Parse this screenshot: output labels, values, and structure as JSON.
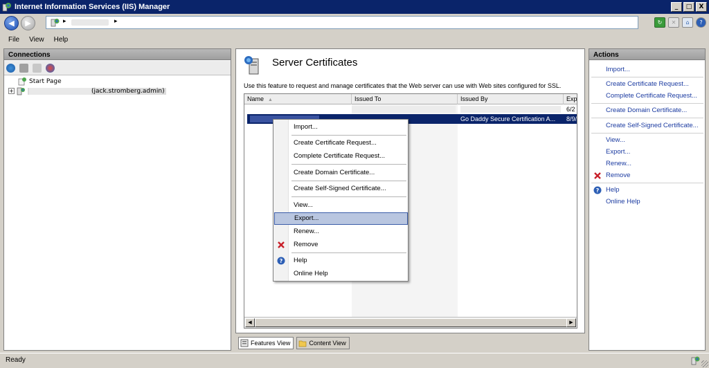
{
  "window": {
    "title": "Internet Information Services (IIS) Manager",
    "min_label": "_",
    "max_label": "□",
    "close_label": "X"
  },
  "nav": {
    "back_label": "◀",
    "forward_label": "▶",
    "address_arrow": "▸",
    "address_arrow2": "▸"
  },
  "menu": [
    {
      "label": "File"
    },
    {
      "label": "View"
    },
    {
      "label": "Help"
    }
  ],
  "connections": {
    "title": "Connections",
    "tree": [
      {
        "label": "Start Page"
      },
      {
        "label": "(jack.stromberg.admin)",
        "expander": "+"
      }
    ]
  },
  "feature": {
    "title": "Server Certificates",
    "description": "Use this feature to request and manage certificates that the Web server can use with Web sites configured for SSL."
  },
  "grid": {
    "columns": [
      "Name",
      "Issued To",
      "Issued By",
      "Exp"
    ],
    "sort_indicator": "▲",
    "rows": [
      {
        "name": "",
        "issued_to": "",
        "issued_by": "",
        "exp": "6/2"
      },
      {
        "name": "",
        "issued_to": "",
        "issued_by": "Go Daddy Secure Certification A...",
        "exp": "8/9/"
      }
    ],
    "scroll_left": "◀",
    "scroll_right": "▶"
  },
  "view_tabs": {
    "features": "Features View",
    "content": "Content View"
  },
  "actions": {
    "title": "Actions",
    "items": [
      {
        "label": "Import..."
      },
      {
        "label": "Create Certificate Request..."
      },
      {
        "label": "Complete Certificate Request..."
      },
      {
        "label": "Create Domain Certificate..."
      },
      {
        "label": "Create Self-Signed Certificate..."
      },
      {
        "label": "View..."
      },
      {
        "label": "Export..."
      },
      {
        "label": "Renew..."
      },
      {
        "label": "Remove"
      },
      {
        "label": "Help"
      },
      {
        "label": "Online Help"
      }
    ]
  },
  "context_menu": {
    "items": [
      {
        "label": "Import..."
      },
      {
        "label": "Create Certificate Request..."
      },
      {
        "label": "Complete Certificate Request..."
      },
      {
        "label": "Create Domain Certificate..."
      },
      {
        "label": "Create Self-Signed Certificate..."
      },
      {
        "label": "View..."
      },
      {
        "label": "Export...",
        "highlighted": true
      },
      {
        "label": "Renew..."
      },
      {
        "label": "Remove"
      },
      {
        "label": "Help"
      },
      {
        "label": "Online Help"
      }
    ]
  },
  "status": {
    "text": "Ready"
  },
  "colors": {
    "title_bar": "#0a246a",
    "selection": "#0a246a",
    "link": "#1a3aa0",
    "remove_red": "#c8202a"
  }
}
